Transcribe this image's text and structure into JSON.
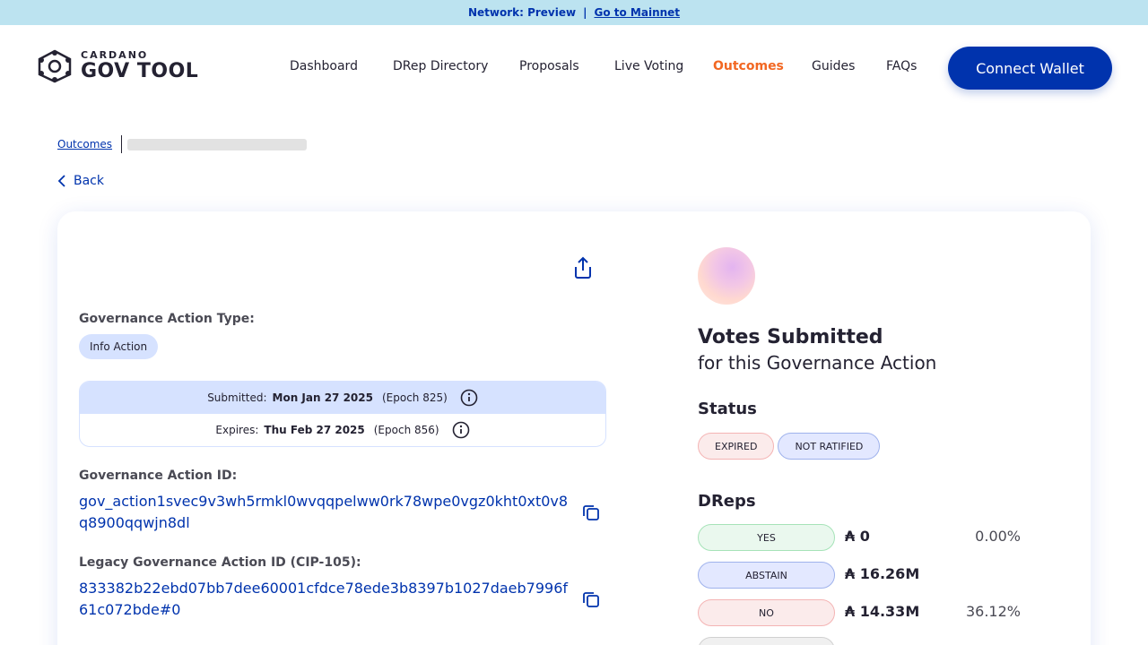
{
  "network_bar": {
    "label": "Network: Preview",
    "separator": "|",
    "link": "Go to Mainnet"
  },
  "logo": {
    "small": "CARDANO",
    "big": "GOV TOOL"
  },
  "nav": [
    "Dashboard",
    "DRep Directory",
    "Proposals",
    "Live Voting",
    "Outcomes",
    "Guides",
    "FAQs"
  ],
  "nav_active": "Outcomes",
  "connect_wallet": "Connect Wallet",
  "breadcrumb": {
    "root": "Outcomes"
  },
  "back_label": "Back",
  "action": {
    "type_label": "Governance Action Type:",
    "type_value": "Info Action",
    "submitted": {
      "prefix": "Submitted:",
      "date": "Mon Jan 27 2025",
      "epoch": "(Epoch 825)"
    },
    "expires": {
      "prefix": "Expires:",
      "date": "Thu Feb 27 2025",
      "epoch": "(Epoch 856)"
    },
    "id_label": "Governance Action ID:",
    "id_value": "gov_action1svec9v3wh5rmkl0wvqqpelww0rk78wpe0vgz0kht0xt0v8q8900qqwjn8dl",
    "legacy_label": "Legacy Governance Action ID (CIP-105):",
    "legacy_value": "833382b22ebd07bb7dee60001cfdce78ede3b8397b1027daeb7996f61c072bde#0"
  },
  "votes": {
    "title": "Votes Submitted",
    "subtitle": "for this Governance Action",
    "status_label": "Status",
    "status_chips": [
      "EXPIRED",
      "NOT RATIFIED"
    ],
    "dreps_label": "DReps",
    "rows": [
      {
        "label": "YES",
        "amount": "₳ 0",
        "percent": "0.00%"
      },
      {
        "label": "ABSTAIN",
        "amount": "₳ 16.26M",
        "percent": ""
      },
      {
        "label": "NO",
        "amount": "₳ 14.33M",
        "percent": "36.12%"
      }
    ]
  }
}
